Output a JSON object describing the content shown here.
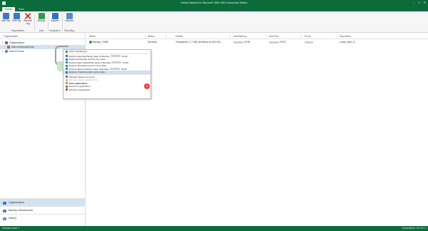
{
  "window": {
    "title": "Veeam Backup for Microsoft Office 365 Community Edition",
    "controls": [
      "–",
      "□",
      "✕"
    ]
  },
  "tabs": [
    {
      "label": "Home",
      "active": true
    },
    {
      "label": "View",
      "active": false
    }
  ],
  "ribbon": {
    "buttons": [
      {
        "label": "Add Org",
        "icon": "add-org-icon",
        "color": "#3a78c4"
      },
      {
        "label": "Edit Org",
        "icon": "edit-org-icon",
        "color": "#3a78c4"
      },
      {
        "label": "Remove Org",
        "icon": "remove-org-icon",
        "color": "#d9332b"
      },
      {
        "label": "Backup",
        "icon": "backup-icon",
        "color": "#2e9b47"
      },
      {
        "label": "Explore",
        "icon": "explore-icon",
        "color": "#2f72c0"
      },
      {
        "label": "Reports",
        "icon": "reports-icon",
        "color": "#5b8bd0"
      }
    ],
    "groups": [
      "Organization",
      "Jobs",
      "Integration",
      "Reporting"
    ]
  },
  "left_pane": {
    "header": "Organization",
    "tree": [
      {
        "label": "Organizations",
        "level": 0
      },
      {
        "label": "stdo.onmicrosoft.com",
        "level": 1,
        "selected": true
      },
      {
        "label": "Last 24 hours",
        "level": 0
      }
    ]
  },
  "bottom_nav": [
    {
      "label": "Organizations",
      "active": true,
      "color": "#3a78c4"
    },
    {
      "label": "Backup Infrastructure",
      "active": false,
      "color": "#5a7fa8"
    },
    {
      "label": "History",
      "active": false,
      "color": "#7a8fa8"
    }
  ],
  "grid": {
    "columns": [
      "Name",
      "Status",
      "Details",
      "Last Backup",
      "Next Run",
      "Proxy",
      "Repository"
    ],
    "rows": [
      {
        "name": "Backup_O365",
        "status": "Success",
        "details": "Transferred: 2.7 MB (36 items) at 63.5 KB...",
        "last_backup_time": "23:00",
        "next_run_time": "23:00",
        "repository": "Local_drive_E"
      }
    ]
  },
  "context_menu": {
    "items": [
      {
        "label": "Add to backup job...",
        "icon": "add-icon",
        "color": "#2e9b47",
        "enabled": true
      },
      {
        "separator": true
      },
      {
        "label": "Explore latest Exchange state of Monday,",
        "suffix": "23:00",
        "icon": "exchange-icon",
        "color": "#2f72c0",
        "enabled": true
      },
      {
        "label": "Explore Exchange point-in-time state...",
        "icon": "exchange-icon",
        "color": "#2f72c0",
        "enabled": true
      },
      {
        "label": "Explore latest SharePoint state of Monday,",
        "suffix": "23:00",
        "icon": "sharepoint-icon",
        "color": "#2a8a8a",
        "enabled": true
      },
      {
        "label": "Explore SharePoint point-in-time state...",
        "icon": "sharepoint-icon",
        "color": "#2a8a8a",
        "enabled": true
      },
      {
        "label": "Explore latest OneDrive state of Monday,",
        "suffix": "23:00",
        "icon": "onedrive-icon",
        "color": "#2f72c0",
        "enabled": true
      },
      {
        "label": "Explore OneDrive point-in-time state...",
        "icon": "onedrive-icon",
        "color": "#2f72c0",
        "enabled": true,
        "highlighted": true
      },
      {
        "separator": true
      },
      {
        "label": "Manage backup accounts...",
        "icon": "accounts-icon",
        "color": "#6a6a6a",
        "enabled": true
      },
      {
        "label": "Manage backup applications...",
        "icon": "apps-icon",
        "color": "#9a9a9a",
        "enabled": false
      },
      {
        "label": "Edit organization...",
        "icon": "edit-icon",
        "color": "#d08a1a",
        "enabled": true,
        "bold": true
      },
      {
        "label": "Rename organization...",
        "icon": "rename-icon",
        "color": "#6a6a6a",
        "enabled": true
      },
      {
        "label": "Remove organization",
        "icon": "remove-icon",
        "color": "#d9332b",
        "enabled": true
      }
    ]
  },
  "annotation_badge": "1",
  "status_bar": {
    "left": "Licenses used: 1",
    "right": "Connected to: 127.0.0.1"
  }
}
